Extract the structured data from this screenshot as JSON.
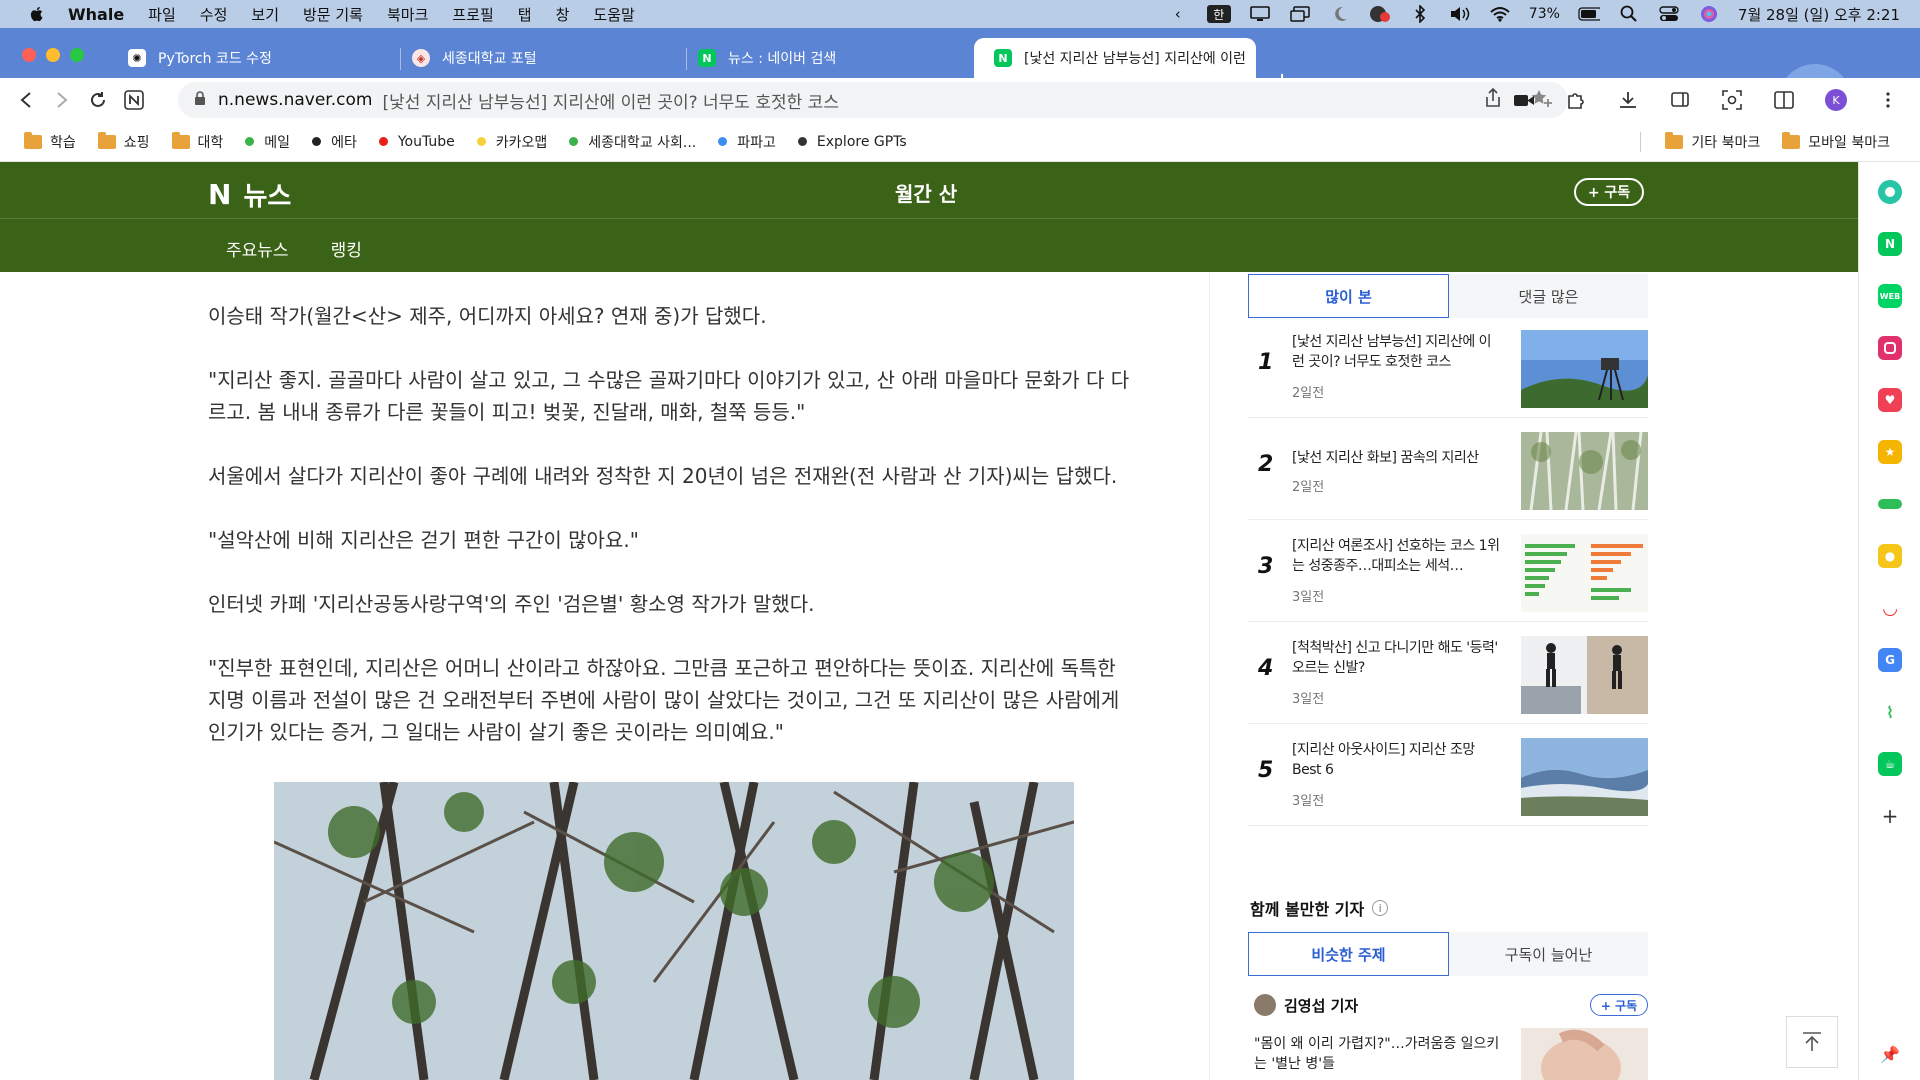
{
  "menubar": {
    "app": "Whale",
    "items": [
      "파일",
      "수정",
      "보기",
      "방문 기록",
      "북마크",
      "프로필",
      "탭",
      "창",
      "도움말"
    ],
    "input_mode": "한",
    "battery": "73%",
    "datetime": "7월 28일 (일) 오후 2:21"
  },
  "tabs": [
    {
      "title": "PyTorch 코드 수정",
      "favicon": "openai-icon"
    },
    {
      "title": "세종대학교 포털",
      "favicon": "sejong-icon"
    },
    {
      "title": "뉴스 : 네이버 검색",
      "favicon": "naver-icon"
    },
    {
      "title": "[낯선 지리산 남부능선] 지리산에 이런",
      "favicon": "naver-icon"
    }
  ],
  "url": {
    "domain": "n.news.naver.com",
    "page_title": "[낯선 지리산 남부능선] 지리산에 이런 곳이? 너무도 호젓한 코스"
  },
  "bookmarks": [
    {
      "label": "학습",
      "type": "folder"
    },
    {
      "label": "쇼핑",
      "type": "folder"
    },
    {
      "label": "대학",
      "type": "folder"
    },
    {
      "label": "메일",
      "type": "dot",
      "color": "#3cb24a"
    },
    {
      "label": "에타",
      "type": "dot",
      "color": "#222222"
    },
    {
      "label": "YouTube",
      "type": "dot",
      "color": "#e62117"
    },
    {
      "label": "카카오맵",
      "type": "dot",
      "color": "#f5d13b"
    },
    {
      "label": "세종대학교 사회...",
      "type": "dot",
      "color": "#3cb24a"
    },
    {
      "label": "파파고",
      "type": "dot",
      "color": "#3c8ef0"
    },
    {
      "label": "Explore GPTs",
      "type": "dot",
      "color": "#333333"
    }
  ],
  "bookmarks_right": [
    "기타 북마크",
    "모바일 북마크"
  ],
  "header": {
    "logo_text": "뉴스",
    "press": "월간 산",
    "subscribe": "+ 구독",
    "nav": [
      "주요뉴스",
      "랭킹"
    ]
  },
  "article": {
    "paragraphs": [
      "이승태 작가(월간<산> 제주, 어디까지 아세요? 연재 중)가 답했다.",
      "\"지리산 좋지. 골골마다 사람이 살고 있고, 그 수많은 골짜기마다 이야기가 있고, 산 아래 마을마다 문화가 다 다르고. 봄 내내 종류가 다른 꽃들이 피고! 벚꽃, 진달래, 매화, 철쭉 등등.\"",
      "서울에서 살다가 지리산이 좋아 구례에 내려와 정착한 지 20년이 넘은 전재완(전 사람과 산 기자)씨는 답했다.",
      "\"설악산에 비해 지리산은 걷기 편한 구간이 많아요.\"",
      "인터넷 카페 '지리산공동사랑구역'의 주인 '검은별' 황소영 작가가 말했다.",
      "\"진부한 표현인데, 지리산은 어머니 산이라고 하잖아요. 그만큼 포근하고 편안하다는 뜻이죠. 지리산에 독특한 지명 이름과 전설이 많은 건 오래전부터 주변에 사람이 많이 살았다는 것이고, 그건 또 지리산이 많은 사람에게 인기가 있다는 증거, 그 일대는 사람이 살기 좋은 곳이라는 의미예요.\""
    ]
  },
  "ranking": {
    "tabs": [
      "많이 본",
      "댓글 많은"
    ],
    "items": [
      {
        "rank": "1",
        "title": "[낯선 지리산 남부능선] 지리산에 이런 곳이? 너무도 호젓한 코스",
        "age": "2일전"
      },
      {
        "rank": "2",
        "title": "[낯선 지리산 화보] 꿈속의 지리산",
        "age": "2일전"
      },
      {
        "rank": "3",
        "title": "[지리산 여론조사] 선호하는 코스 1위는 성중종주…대피소는 세석…",
        "age": "3일전"
      },
      {
        "rank": "4",
        "title": "[척척박산] 신고 다니기만 해도 '등력' 오르는 신발?",
        "age": "3일전"
      },
      {
        "rank": "5",
        "title": "[지리산 아웃사이드] 지리산 조망 Best 6",
        "age": "3일전"
      }
    ]
  },
  "together": {
    "title": "함께 볼만한 기자",
    "info": "i",
    "tabs": [
      "비슷한 주제",
      "구독이 늘어난"
    ],
    "reporter": "김영섭 기자",
    "subscribe": "+ 구독",
    "rec_title": "\"몸이 왜 이리 가렵지?\"…가려움증 일으키는 '별난 병'들"
  },
  "sidebar": [
    {
      "icon": "whale-green-icon",
      "color": "#27c5a5"
    },
    {
      "icon": "naver-icon",
      "color": "#03c75a"
    },
    {
      "icon": "webtoon-icon",
      "color": "#00d564"
    },
    {
      "icon": "instagram-icon",
      "color": "#e1306c"
    },
    {
      "icon": "pocket-icon",
      "color": "#ef4056"
    },
    {
      "icon": "star-icon",
      "color": "#f4b400"
    },
    {
      "icon": "wallet-icon",
      "color": "#2dbe5a"
    },
    {
      "icon": "map-pin-icon",
      "color": "#f5c518"
    },
    {
      "icon": "smile-icon",
      "color": "#ff2d2d"
    },
    {
      "icon": "translate-icon",
      "color": "#4285f4"
    },
    {
      "icon": "stock-icon",
      "color": "#2dbe5a"
    },
    {
      "icon": "naver-cafe-icon",
      "color": "#03c75a"
    },
    {
      "icon": "add-icon",
      "color": "#333333"
    }
  ]
}
